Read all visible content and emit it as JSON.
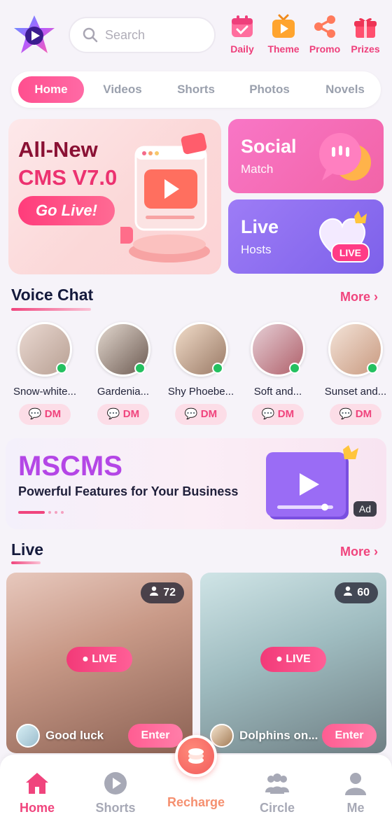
{
  "header": {
    "search_placeholder": "Search",
    "shortcuts": [
      {
        "label": "Daily",
        "icon": "calendar-icon"
      },
      {
        "label": "Theme",
        "icon": "tv-icon"
      },
      {
        "label": "Promo",
        "icon": "share-icon"
      },
      {
        "label": "Prizes",
        "icon": "gift-icon"
      }
    ]
  },
  "tabs": [
    "Home",
    "Videos",
    "Shorts",
    "Photos",
    "Novels"
  ],
  "active_tab": "Home",
  "hero": {
    "line1": "All-New",
    "line2": "CMS V7.0",
    "button": "Go Live!"
  },
  "cards": {
    "social": {
      "title": "Social",
      "subtitle": "Match"
    },
    "live": {
      "title": "Live",
      "subtitle": "Hosts",
      "badge": "LIVE"
    }
  },
  "voice_chat": {
    "title": "Voice Chat",
    "more": "More",
    "users": [
      {
        "name": "Snow-white...",
        "dm": "DM"
      },
      {
        "name": "Gardenia...",
        "dm": "DM"
      },
      {
        "name": "Shy Phoebe...",
        "dm": "DM"
      },
      {
        "name": "Soft and...",
        "dm": "DM"
      },
      {
        "name": "Sunset and...",
        "dm": "DM"
      }
    ]
  },
  "ad": {
    "brand": "MSCMS",
    "tagline": "Powerful Features for Your Business",
    "badge": "Ad"
  },
  "live": {
    "title": "Live",
    "more": "More",
    "streams": [
      {
        "viewers": "72",
        "badge": "LIVE",
        "host": "Good luck",
        "button": "Enter"
      },
      {
        "viewers": "60",
        "badge": "LIVE",
        "host": "Dolphins on...",
        "button": "Enter"
      }
    ]
  },
  "nav": [
    {
      "label": "Home",
      "icon": "home-icon"
    },
    {
      "label": "Shorts",
      "icon": "play-circle-icon"
    },
    {
      "label": "Recharge",
      "icon": "coins-icon"
    },
    {
      "label": "Circle",
      "icon": "people-icon"
    },
    {
      "label": "Me",
      "icon": "person-icon"
    }
  ],
  "colors": {
    "accent": "#f0447d",
    "online": "#24c060",
    "live_card_purple": "#8a6cf0",
    "social_pink": "#f45fb0"
  }
}
